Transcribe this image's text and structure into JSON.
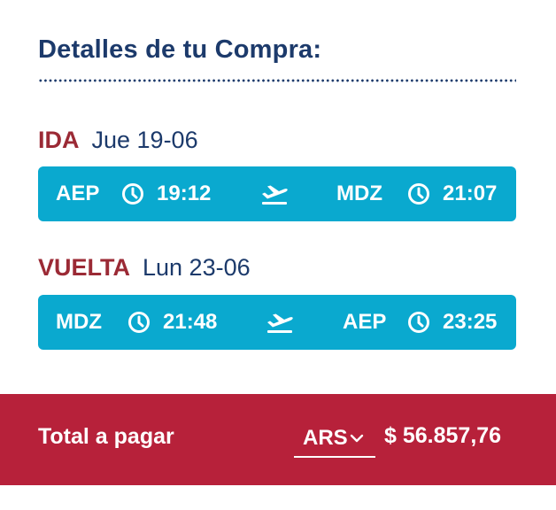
{
  "header": {
    "title": "Detalles de tu Compra:"
  },
  "legs": [
    {
      "kind": "IDA",
      "date": "Jue 19-06",
      "origin": "AEP",
      "depart_time": "19:12",
      "destination": "MDZ",
      "arrive_time": "21:07"
    },
    {
      "kind": "VUELTA",
      "date": "Lun 23-06",
      "origin": "MDZ",
      "depart_time": "21:48",
      "destination": "AEP",
      "arrive_time": "23:25"
    }
  ],
  "footer": {
    "total_label": "Total a pagar",
    "currency": "ARS",
    "amount": "$ 56.857,76"
  },
  "icons": [
    "clock-icon",
    "plane-takeoff-icon",
    "chevron-down-icon"
  ],
  "colors": {
    "navy": "#1c3a6b",
    "accent_red": "#9b2a35",
    "bar_blue": "#0aa9cf",
    "footer_red": "#b7213a"
  }
}
